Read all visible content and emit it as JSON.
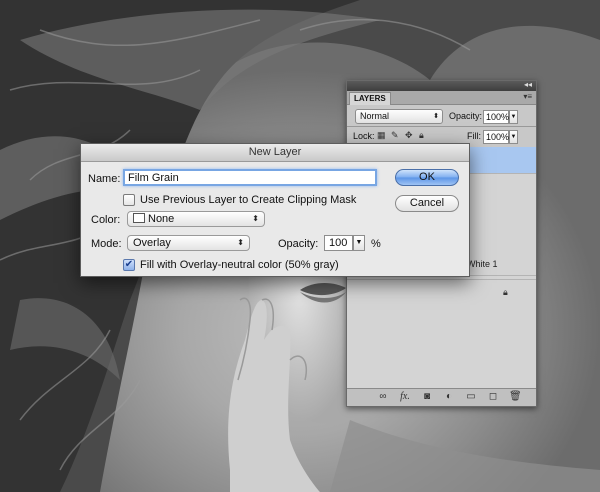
{
  "dialog": {
    "title": "New Layer",
    "name_label": "Name:",
    "name_value": "Film Grain",
    "clipping_label": "Use Previous Layer to Create Clipping Mask",
    "clipping_checked": false,
    "color_label": "Color:",
    "color_value": "None",
    "mode_label": "Mode:",
    "mode_value": "Overlay",
    "opacity_label": "Opacity:",
    "opacity_value": "100",
    "opacity_unit": "%",
    "fill_label": "Fill with Overlay-neutral color (50% gray)",
    "fill_checked": true,
    "ok_label": "OK",
    "cancel_label": "Cancel"
  },
  "layers_panel": {
    "tab_label": "LAYERS",
    "blend_mode": "Normal",
    "opacity_label": "Opacity:",
    "opacity_value": "100%",
    "lock_label": "Lock:",
    "fill_label": "Fill:",
    "fill_value": "100%",
    "partial_layer_name": "White 1",
    "fx_label": "fx."
  },
  "colors": {
    "selected_layer": "#a8c7f0",
    "ok_button": "#6fa3ec"
  }
}
